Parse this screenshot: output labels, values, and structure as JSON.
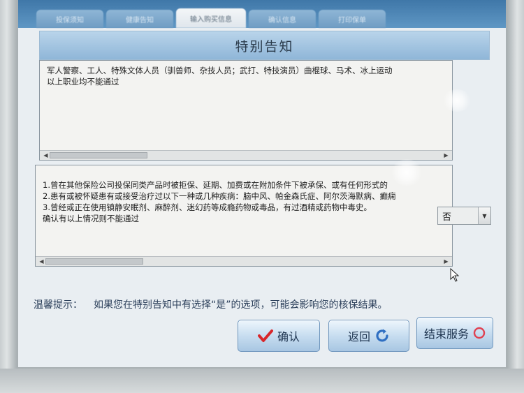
{
  "tabs": [
    {
      "label": "投保须知",
      "active": false
    },
    {
      "label": "健康告知",
      "active": false
    },
    {
      "label": "输入购买信息",
      "active": true
    },
    {
      "label": "确认信息",
      "active": false
    },
    {
      "label": "打印保单",
      "active": false
    }
  ],
  "title": "特别告知",
  "notice_occupation": {
    "lines": [
      "军人警察、工人、特殊文体人员（驯兽师、杂技人员；武打、特技演员）曲棍球、马术、冰上运动",
      "以上职业均不能通过"
    ]
  },
  "notice_health": {
    "lines": [
      "1.曾在其他保险公司投保同类产品时被拒保、延期、加费或在附加条件下被承保、或有任何形式的",
      "2.患有或被怀疑患有或接受治疗过以下一种或几种疾病：脑中风、帕金森氏症、阿尔茨海默病、癫痫",
      "3.曾经或正在使用镇静安眠剂、麻醉剂、迷幻药等成瘾药物或毒品，有过酒精或药物中毒史。",
      "确认有以上情况则不能通过"
    ]
  },
  "answer_select": {
    "value": "否"
  },
  "hint": {
    "label": "温馨提示：",
    "text": "如果您在特别告知中有选择“是”的选项，可能会影响您的核保结果。"
  },
  "buttons": {
    "confirm": "确认",
    "back": "返回",
    "end": "结束服务"
  },
  "colors": {
    "confirm_check": "#d8262a",
    "back_icon": "#2f6fc2",
    "end_icon": "#e04050"
  },
  "icons": {
    "confirm": "checkmark-icon",
    "back": "refresh-icon",
    "end": "power-icon"
  }
}
